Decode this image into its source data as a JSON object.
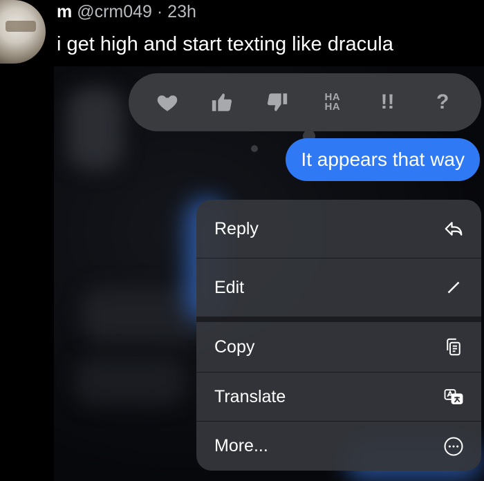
{
  "tweet": {
    "display_name": "m",
    "handle": "@crm049",
    "time": "· 23h",
    "text": "i get high and start texting like dracula"
  },
  "tapback": {
    "reactions": [
      "heart-icon",
      "thumbs-up-icon",
      "thumbs-down-icon",
      "haha-icon",
      "exclamation-icon",
      "question-icon"
    ],
    "haha_top": "HA",
    "haha_bottom": "HA",
    "exclamation": "!!",
    "question": "?"
  },
  "message": {
    "sent_text": "It appears that way",
    "bubble_color": "#2f79f4"
  },
  "menu": {
    "items": [
      {
        "label": "Reply",
        "icon": "reply-icon"
      },
      {
        "label": "Edit",
        "icon": "pencil-icon"
      },
      {
        "label": "Copy",
        "icon": "copy-icon"
      },
      {
        "label": "Translate",
        "icon": "translate-icon"
      },
      {
        "label": "More...",
        "icon": "more-icon"
      }
    ]
  }
}
